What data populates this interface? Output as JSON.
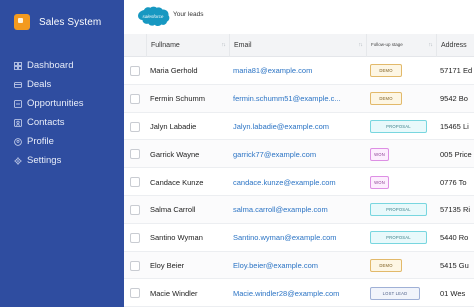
{
  "app": {
    "title": "Sales System"
  },
  "sidebar": {
    "items": [
      {
        "label": "Dashboard",
        "icon": "grid-icon"
      },
      {
        "label": "Deals",
        "icon": "deal-icon"
      },
      {
        "label": "Opportunities",
        "icon": "opportunities-icon"
      },
      {
        "label": "Contacts",
        "icon": "contacts-icon"
      },
      {
        "label": "Profile",
        "icon": "profile-icon"
      },
      {
        "label": "Settings",
        "icon": "gear-icon"
      }
    ]
  },
  "header": {
    "logo_text": "salesforce",
    "title": "Your leads"
  },
  "table": {
    "columns": [
      "Fullname",
      "Email",
      "Follow-up stage",
      "Address"
    ],
    "rows": [
      {
        "name": "Maria Gerhold",
        "email": "maria81@example.com",
        "stage": "DEMO",
        "stage_type": "demo",
        "address": "57171 Ed"
      },
      {
        "name": "Fermin Schumm",
        "email": "fermin.schumm51@example.c...",
        "stage": "DEMO",
        "stage_type": "demo",
        "address": "9542 Bo"
      },
      {
        "name": "Jalyn Labadie",
        "email": "Jalyn.labadie@example.com",
        "stage": "PROPOSAL",
        "stage_type": "proposal",
        "address": "15465 Li"
      },
      {
        "name": "Garrick Wayne",
        "email": "garrick77@example.com",
        "stage": "WON",
        "stage_type": "won",
        "address": "005 Price"
      },
      {
        "name": "Candace Kunze",
        "email": "candace.kunze@example.com",
        "stage": "WON",
        "stage_type": "won",
        "address": "0776 To"
      },
      {
        "name": "Salma Carroll",
        "email": "salma.carroll@example.com",
        "stage": "PROPOSAL",
        "stage_type": "proposal",
        "address": "57135 Ri"
      },
      {
        "name": "Santino Wyman",
        "email": "Santino.wyman@example.com",
        "stage": "PROPOSAL",
        "stage_type": "proposal",
        "address": "5440 Ro"
      },
      {
        "name": "Eloy Beier",
        "email": "Eloy.beier@example.com",
        "stage": "DEMO",
        "stage_type": "demo",
        "address": "5415 Gu"
      },
      {
        "name": "Macie Windler",
        "email": "Macie.windler28@example.com",
        "stage": "LOST LEAD",
        "stage_type": "lost",
        "address": "01 Wes"
      }
    ]
  },
  "colors": {
    "sidebar_bg": "#2f4da0",
    "brand_accent": "#f39a1f",
    "link": "#2a73c4",
    "salesforce_blue": "#1798c1"
  }
}
